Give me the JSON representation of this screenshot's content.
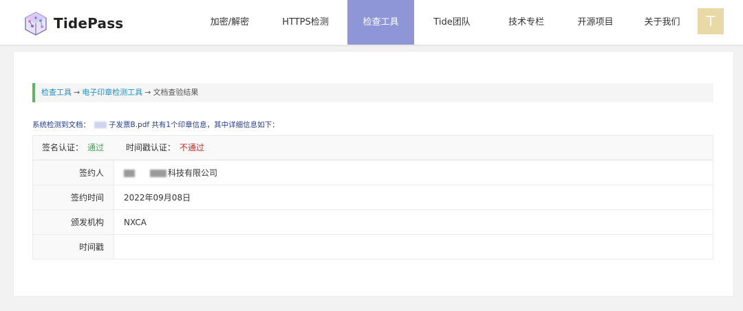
{
  "brand": {
    "name": "TidePass"
  },
  "nav": {
    "items": [
      {
        "label": "加密/解密"
      },
      {
        "label": "HTTPS检测"
      },
      {
        "label": "检查工具"
      },
      {
        "label": "Tide团队"
      },
      {
        "label": "技术专栏"
      },
      {
        "label": "开源项目"
      },
      {
        "label": "关于我们"
      }
    ],
    "active_index": 2
  },
  "user": {
    "avatar_letter": "T"
  },
  "breadcrumb": {
    "item1": "检查工具",
    "item2": "电子印章检测工具",
    "current": "文档查验结果",
    "separator": "→"
  },
  "summary": {
    "prefix": "系统检测到文档：",
    "doc_name": "子发票B.pdf",
    "suffix": " 共有1个印章信息，其中详细信息如下："
  },
  "status": {
    "sign_label": "签名认证：",
    "sign_value": "通过",
    "time_label": "时间戳认证：",
    "time_value": "不通过"
  },
  "details": [
    {
      "key": "签约人",
      "value": "科技有限公司"
    },
    {
      "key": "签约时间",
      "value": "2022年09月08日"
    },
    {
      "key": "颁发机构",
      "value": "NXCA"
    },
    {
      "key": "时间戳",
      "value": ""
    }
  ],
  "colors": {
    "accent_nav": "#8e96d8",
    "ok": "#3aa84e",
    "fail": "#d0281e",
    "link": "#1e90c8",
    "summary": "#233d8f"
  },
  "icons": {
    "logo": "tidepass-logo-icon"
  }
}
